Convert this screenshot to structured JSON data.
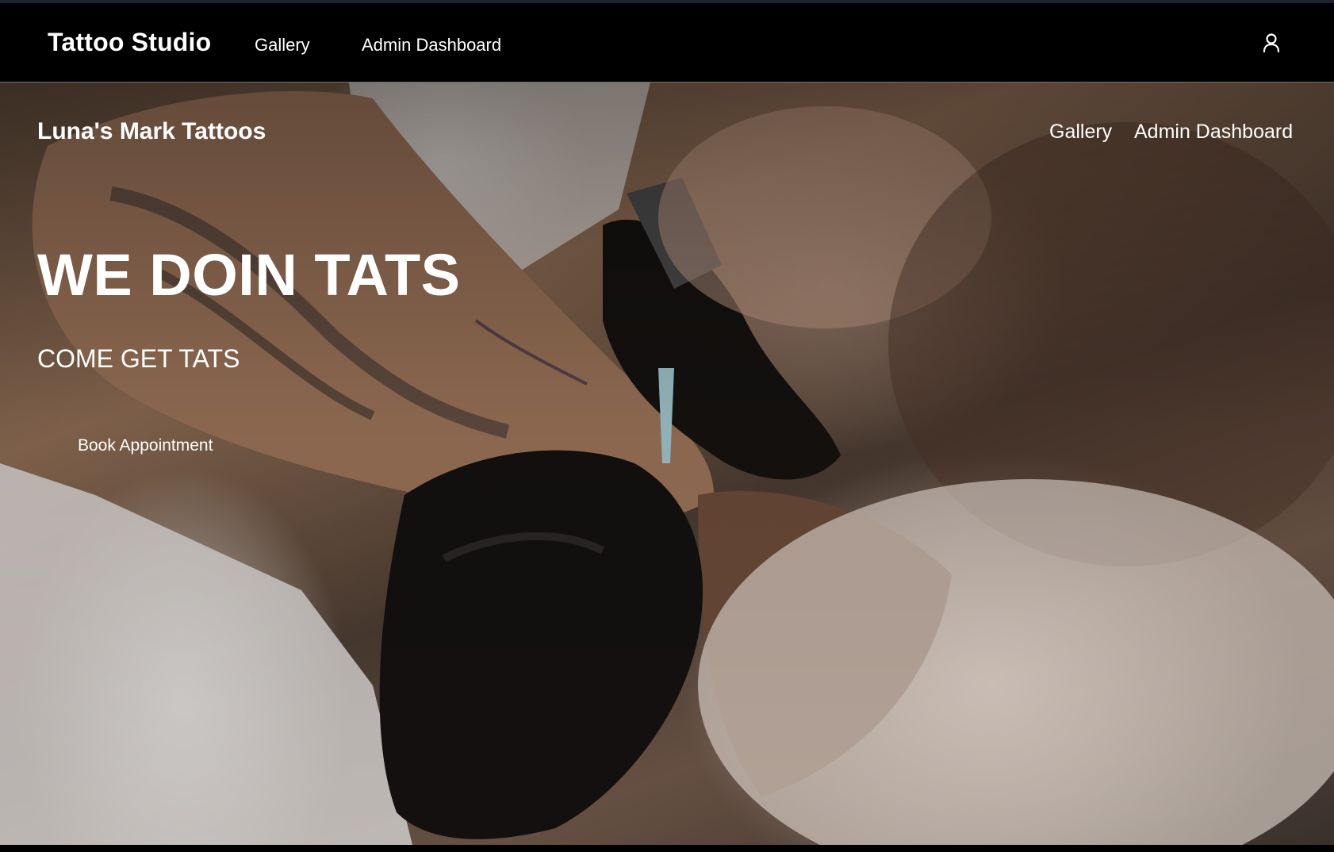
{
  "app_nav": {
    "brand": "Tattoo Studio",
    "links": [
      "Gallery",
      "Admin Dashboard"
    ],
    "user_icon": "user-icon"
  },
  "site_header": {
    "name": "Luna's Mark Tattoos",
    "links": [
      "Gallery",
      "Admin Dashboard"
    ]
  },
  "hero": {
    "headline": "WE DOIN TATS",
    "subheadline": "COME GET TATS",
    "cta_label": "Book Appointment",
    "image": "tattoo-artist-photo"
  },
  "colors": {
    "nav_background": "#000000",
    "text": "#ffffff",
    "nav_border": "#6f6f6f"
  }
}
